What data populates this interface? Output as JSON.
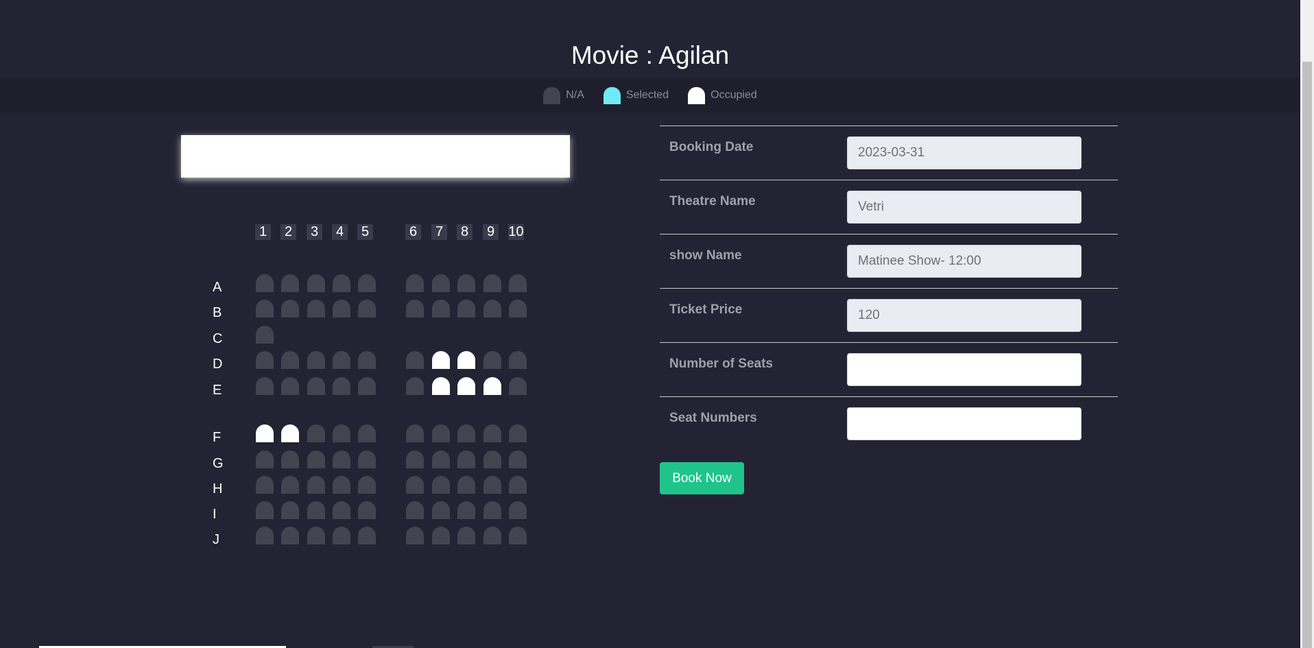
{
  "page_title": "Movie : Agilan",
  "legend": [
    {
      "label": "N/A",
      "color": "#444451"
    },
    {
      "label": "Selected",
      "color": "#6feaf6"
    },
    {
      "label": "Occupied",
      "color": "#ffffff"
    }
  ],
  "seat_map": {
    "columns": [
      "1",
      "2",
      "3",
      "4",
      "5",
      "6",
      "7",
      "8",
      "9",
      "10"
    ],
    "rows": [
      {
        "label": "A",
        "seats": [
          "na",
          "na",
          "na",
          "na",
          "na",
          "na",
          "na",
          "na",
          "na",
          "na"
        ]
      },
      {
        "label": "B",
        "seats": [
          "na",
          "na",
          "na",
          "na",
          "na",
          "na",
          "na",
          "na",
          "na",
          "na"
        ]
      },
      {
        "label": "C",
        "seats": [
          "na"
        ]
      },
      {
        "label": "D",
        "seats": [
          "na",
          "na",
          "na",
          "na",
          "na",
          "na",
          "occupied",
          "occupied",
          "na",
          "na"
        ]
      },
      {
        "label": "E",
        "seats": [
          "na",
          "na",
          "na",
          "na",
          "na",
          "na",
          "occupied",
          "occupied",
          "occupied",
          "na"
        ]
      },
      {
        "label": "F",
        "seats": [
          "occupied",
          "occupied",
          "na",
          "na",
          "na",
          "na",
          "na",
          "na",
          "na",
          "na"
        ]
      },
      {
        "label": "G",
        "seats": [
          "na",
          "na",
          "na",
          "na",
          "na",
          "na",
          "na",
          "na",
          "na",
          "na"
        ]
      },
      {
        "label": "H",
        "seats": [
          "na",
          "na",
          "na",
          "na",
          "na",
          "na",
          "na",
          "na",
          "na",
          "na"
        ]
      },
      {
        "label": "I",
        "seats": [
          "na",
          "na",
          "na",
          "na",
          "na",
          "na",
          "na",
          "na",
          "na",
          "na"
        ]
      },
      {
        "label": "J",
        "seats": [
          "na",
          "na",
          "na",
          "na",
          "na",
          "na",
          "na",
          "na",
          "na",
          "na"
        ]
      }
    ]
  },
  "form": {
    "booking_date": {
      "label": "Booking Date",
      "value": "2023-03-31"
    },
    "theatre_name": {
      "label": "Theatre Name",
      "value": "Vetri"
    },
    "show_name": {
      "label": "show Name",
      "value": "Matinee Show- 12:00"
    },
    "ticket_price": {
      "label": "Ticket Price",
      "value": "120"
    },
    "number_of_seats": {
      "label": "Number of Seats",
      "value": ""
    },
    "seat_numbers": {
      "label": "Seat Numbers",
      "value": ""
    }
  },
  "book_button": "Book Now"
}
